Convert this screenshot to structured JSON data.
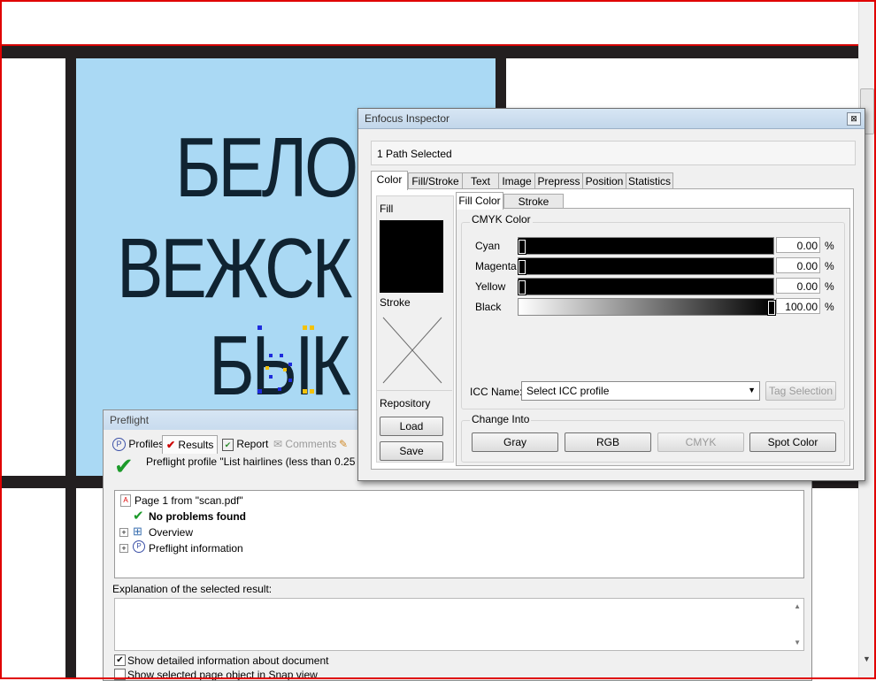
{
  "document": {
    "lines": [
      "БЕЛО",
      "ВЕЖСК",
      "БЫК"
    ]
  },
  "inspector": {
    "title": "Enfocus Inspector",
    "close_glyph": "⊠",
    "status": "1 Path Selected",
    "tabs": [
      "Color",
      "Fill/Stroke",
      "Text",
      "Image",
      "Prepress",
      "Position",
      "Statistics"
    ],
    "active_tab": "Color",
    "fill_label": "Fill",
    "stroke_label": "Stroke",
    "repository_label": "Repository",
    "load_label": "Load",
    "save_label": "Save",
    "sub_tabs": [
      "Fill Color",
      "Stroke Color"
    ],
    "cmyk_group_label": "CMYK Color",
    "channels": [
      {
        "name": "Cyan",
        "value": "0.00",
        "unit": "%",
        "level": 0
      },
      {
        "name": "Magenta",
        "value": "0.00",
        "unit": "%",
        "level": 0
      },
      {
        "name": "Yellow",
        "value": "0.00",
        "unit": "%",
        "level": 0
      },
      {
        "name": "Black",
        "value": "100.00",
        "unit": "%",
        "level": 100
      }
    ],
    "icc_label": "ICC Name:",
    "icc_value": "Select ICC profile",
    "tag_selection_label": "Tag Selection",
    "change_into_label": "Change Into",
    "change_buttons": [
      "Gray",
      "RGB",
      "CMYK",
      "Spot Color"
    ]
  },
  "preflight": {
    "title": "Preflight",
    "tabs": [
      "Profiles",
      "Results",
      "Report",
      "Comments"
    ],
    "profile_line": "Preflight profile \"List hairlines (less than 0.25 pt)\" e",
    "tree": {
      "page": "Page 1 from \"scan.pdf\"",
      "no_problems": "No problems found",
      "overview": "Overview",
      "info": "Preflight information"
    },
    "explanation_label": "Explanation of the selected result:",
    "checkbox_detailed": "Show detailed information about document",
    "checkbox_snap": "Show selected page object in Snap view"
  },
  "colors": {
    "frame": "#e00000",
    "panel": "#aad9f4",
    "check_green": "#1c9a2a"
  }
}
